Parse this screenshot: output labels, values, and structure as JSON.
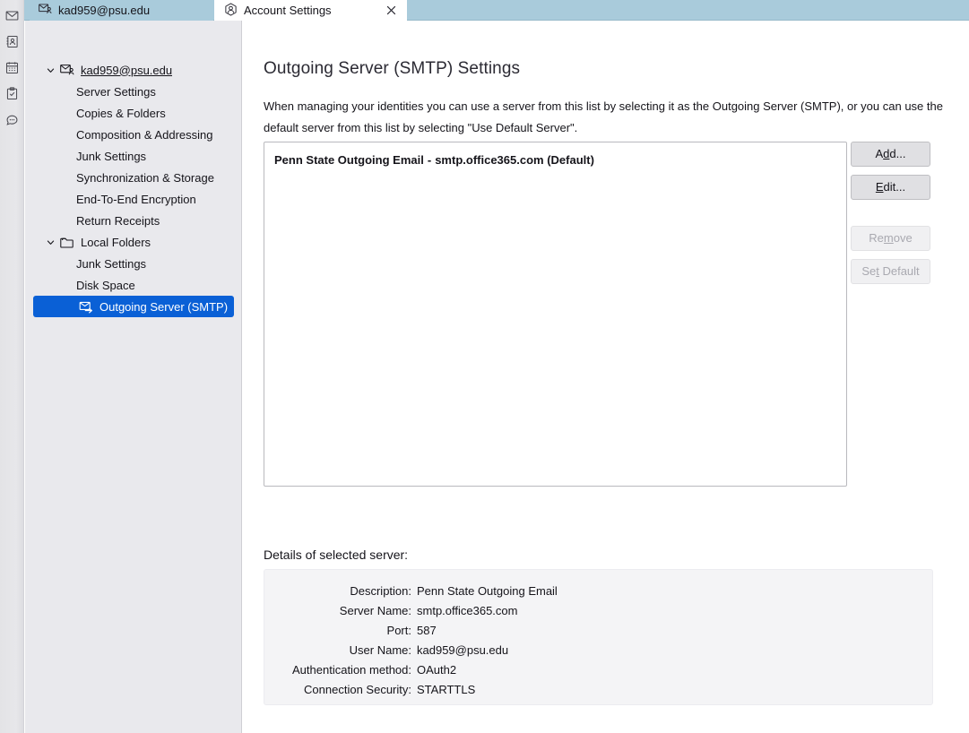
{
  "spaces_bar": {
    "items": [
      {
        "name": "mail-space-icon",
        "icon": "envelope-icon",
        "label": "Mail"
      },
      {
        "name": "address-book-space-icon",
        "icon": "address-book-icon",
        "label": "Address Book"
      },
      {
        "name": "calendar-space-icon",
        "icon": "calendar-icon",
        "label": "Calendar"
      },
      {
        "name": "tasks-space-icon",
        "icon": "clipboard-check-icon",
        "label": "Tasks"
      },
      {
        "name": "chat-space-icon",
        "icon": "chat-bubble-icon",
        "label": "Chat"
      }
    ]
  },
  "tabs": {
    "mail": {
      "label": "kad959@psu.edu",
      "icon": "mail-account-icon"
    },
    "settings": {
      "label": "Account Settings",
      "icon": "account-avatar-icon",
      "close_icon": "close-icon"
    }
  },
  "sidebar": {
    "items": [
      {
        "label": "kad959@psu.edu",
        "level": 0,
        "icon": "mail-account-icon",
        "twisty": "chevron-down-icon",
        "underlined": true,
        "selected": false
      },
      {
        "label": "Server Settings",
        "level": 1,
        "icon": null,
        "twisty": null,
        "underlined": false,
        "selected": false
      },
      {
        "label": "Copies & Folders",
        "level": 1,
        "icon": null,
        "twisty": null,
        "underlined": false,
        "selected": false
      },
      {
        "label": "Composition & Addressing",
        "level": 1,
        "icon": null,
        "twisty": null,
        "underlined": false,
        "selected": false
      },
      {
        "label": "Junk Settings",
        "level": 1,
        "icon": null,
        "twisty": null,
        "underlined": false,
        "selected": false
      },
      {
        "label": "Synchronization & Storage",
        "level": 1,
        "icon": null,
        "twisty": null,
        "underlined": false,
        "selected": false
      },
      {
        "label": "End-To-End Encryption",
        "level": 1,
        "icon": null,
        "twisty": null,
        "underlined": false,
        "selected": false
      },
      {
        "label": "Return Receipts",
        "level": 1,
        "icon": null,
        "twisty": null,
        "underlined": false,
        "selected": false
      },
      {
        "label": "Local Folders",
        "level": 0,
        "icon": "folder-icon",
        "twisty": "chevron-down-icon",
        "underlined": false,
        "selected": false
      },
      {
        "label": "Junk Settings",
        "level": 1,
        "icon": null,
        "twisty": null,
        "underlined": false,
        "selected": false
      },
      {
        "label": "Disk Space",
        "level": 1,
        "icon": null,
        "twisty": null,
        "underlined": false,
        "selected": false
      },
      {
        "label": "Outgoing Server (SMTP)",
        "level": 1,
        "icon": "smtp-server-icon",
        "twisty": null,
        "underlined": false,
        "selected": true
      }
    ],
    "selected_color": "#0a60d6"
  },
  "main": {
    "title": "Outgoing Server (SMTP) Settings",
    "description": "When managing your identities you can use a server from this list by selecting it as the Outgoing Server (SMTP), or you can use the default server from this list by selecting \"Use Default Server\".",
    "server_list": [
      {
        "description": "Penn State Outgoing Email",
        "separator": "-",
        "hostname": "smtp.office365.com",
        "default_marker": "(Default)",
        "selected": false
      }
    ],
    "buttons": [
      {
        "name": "add-button",
        "label_before": "A",
        "label_key": "d",
        "label_after": "d...",
        "disabled": false
      },
      {
        "name": "edit-button",
        "label_before": "",
        "label_key": "E",
        "label_after": "dit...",
        "disabled": false
      },
      {
        "name": "remove-button",
        "label_before": "Re",
        "label_key": "m",
        "label_after": "ove",
        "disabled": true
      },
      {
        "name": "set-default-button",
        "label_before": "Se",
        "label_key": "t",
        "label_after": " Default",
        "disabled": true
      }
    ],
    "details_heading": "Details of selected server:",
    "details": [
      {
        "label": "Description:",
        "value": "Penn State Outgoing Email"
      },
      {
        "label": "Server Name:",
        "value": "smtp.office365.com"
      },
      {
        "label": "Port:",
        "value": "587"
      },
      {
        "label": "User Name:",
        "value": "kad959@psu.edu"
      },
      {
        "label": "Authentication method:",
        "value": "OAuth2"
      },
      {
        "label": "Connection Security:",
        "value": "STARTTLS"
      }
    ]
  }
}
